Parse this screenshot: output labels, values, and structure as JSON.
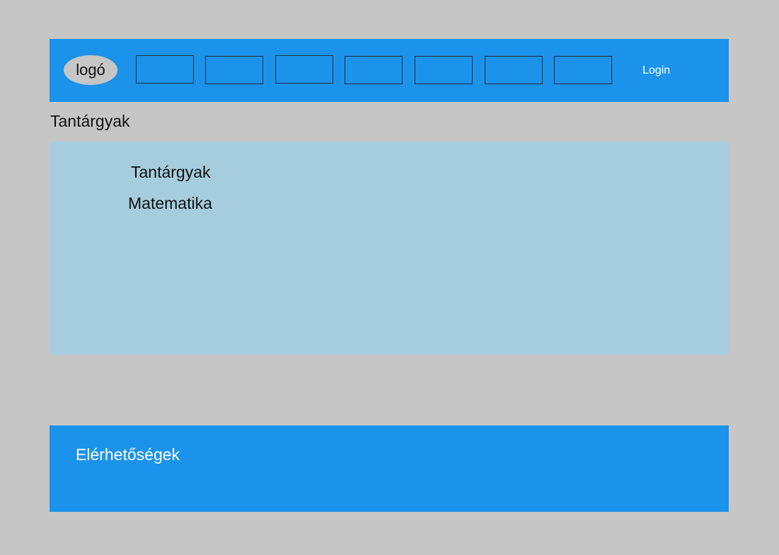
{
  "header": {
    "logo_text": "logó",
    "nav_items": [
      "",
      "",
      "",
      "",
      "",
      "",
      ""
    ],
    "login_label": "Login"
  },
  "page": {
    "title": "Tantárgyak"
  },
  "content": {
    "heading": "Tantárgyak",
    "subjects": [
      "Matematika"
    ]
  },
  "footer": {
    "contact_label": "Elérhetőségek"
  },
  "colors": {
    "background": "#c6c6c6",
    "header": "#1c93eb",
    "content": "#a5cddd",
    "footer": "#1c93eb"
  }
}
